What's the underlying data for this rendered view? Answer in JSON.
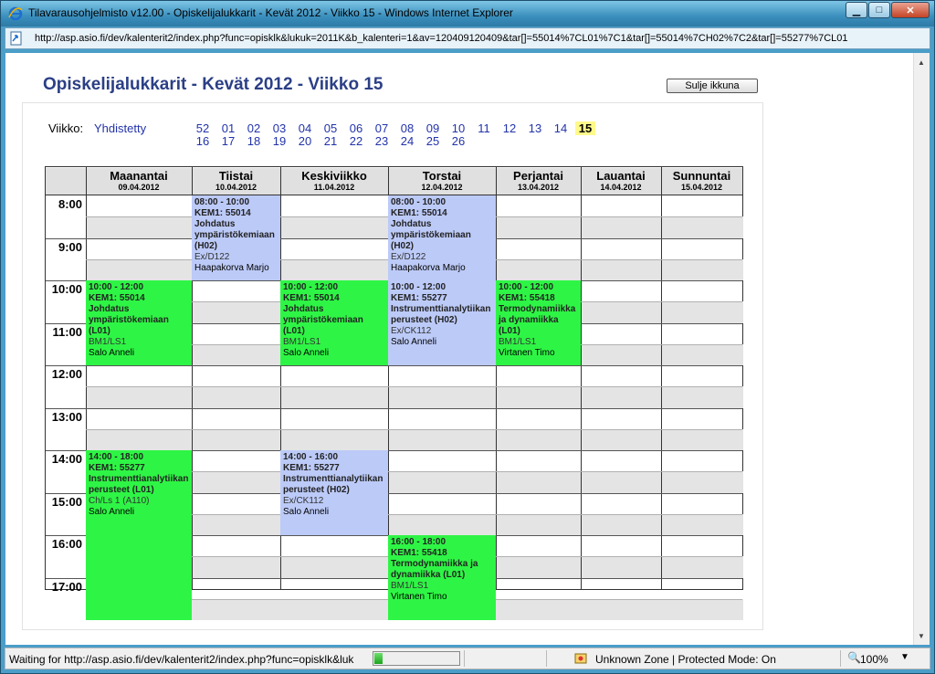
{
  "window": {
    "title": "Tilavarausohjelmisto v12.00 - Opiskelijalukkarit - Kevät 2012 - Viikko 15 - Windows Internet Explorer",
    "url": "http://asp.asio.fi/dev/kalenterit2/index.php?func=opisklk&lukuk=2011K&b_kalenteri=1&av=120409120409&tar[]=55014%7CL01%7C1&tar[]=55014%7CH02%7C2&tar[]=55277%7CL01"
  },
  "page": {
    "title": "Opiskelijalukkarit - Kevät 2012 - Viikko 15",
    "close_button": "Sulje ikkuna",
    "week_label": "Viikko:",
    "combined_link": "Yhdistetty",
    "weeks_row1": [
      "52",
      "01",
      "02",
      "03",
      "04",
      "05",
      "06",
      "07",
      "08",
      "09",
      "10",
      "11",
      "12",
      "13",
      "14",
      "15"
    ],
    "weeks_row2": [
      "16",
      "17",
      "18",
      "19",
      "20",
      "21",
      "22",
      "23",
      "24",
      "25",
      "26"
    ],
    "current_week": "15"
  },
  "calendar": {
    "days": [
      {
        "name": "Maanantai",
        "date": "09.04.2012"
      },
      {
        "name": "Tiistai",
        "date": "10.04.2012"
      },
      {
        "name": "Keskiviikko",
        "date": "11.04.2012"
      },
      {
        "name": "Torstai",
        "date": "12.04.2012"
      },
      {
        "name": "Perjantai",
        "date": "13.04.2012"
      },
      {
        "name": "Lauantai",
        "date": "14.04.2012"
      },
      {
        "name": "Sunnuntai",
        "date": "15.04.2012"
      }
    ],
    "hours": [
      "8:00",
      "9:00",
      "10:00",
      "11:00",
      "12:00",
      "13:00",
      "14:00",
      "15:00",
      "16:00",
      "17:00"
    ],
    "events": [
      {
        "day": 1,
        "start": 8,
        "end": 10,
        "color": "blue",
        "time": "08:00 - 10:00",
        "code": "KEM1: 55014",
        "name": "Johdatus ympäristökemiaan (H02)",
        "room": "Ex/D122",
        "teacher": "Haapakorva Marjo"
      },
      {
        "day": 3,
        "start": 8,
        "end": 10,
        "color": "blue",
        "time": "08:00 - 10:00",
        "code": "KEM1: 55014",
        "name": "Johdatus ympäristökemiaan (H02)",
        "room": "Ex/D122",
        "teacher": "Haapakorva Marjo"
      },
      {
        "day": 0,
        "start": 10,
        "end": 12,
        "color": "green",
        "time": "10:00 - 12:00",
        "code": "KEM1: 55014",
        "name": "Johdatus ympäristökemiaan (L01)",
        "room": "BM1/LS1",
        "teacher": "Salo Anneli"
      },
      {
        "day": 2,
        "start": 10,
        "end": 12,
        "color": "green",
        "time": "10:00 - 12:00",
        "code": "KEM1: 55014",
        "name": "Johdatus ympäristökemiaan (L01)",
        "room": "BM1/LS1",
        "teacher": "Salo Anneli"
      },
      {
        "day": 3,
        "start": 10,
        "end": 12,
        "color": "blue",
        "time": "10:00 - 12:00",
        "code": "KEM1: 55277",
        "name": "Instrumenttianalytiikan perusteet (H02)",
        "room": "Ex/CK112",
        "teacher": "Salo Anneli"
      },
      {
        "day": 4,
        "start": 10,
        "end": 12,
        "color": "green",
        "time": "10:00 - 12:00",
        "code": "KEM1: 55418",
        "name": "Termodynamiikka ja dynamiikka (L01)",
        "room": "BM1/LS1",
        "teacher": "Virtanen Timo"
      },
      {
        "day": 0,
        "start": 14,
        "end": 18,
        "color": "green",
        "time": "14:00 - 18:00",
        "code": "KEM1: 55277",
        "name": "Instrumenttianalytiikan perusteet (L01)",
        "room": "Ch/Ls 1 (A110)",
        "teacher": "Salo Anneli"
      },
      {
        "day": 2,
        "start": 14,
        "end": 16,
        "color": "blue",
        "time": "14:00 - 16:00",
        "code": "KEM1: 55277",
        "name": "Instrumenttianalytiikan perusteet (H02)",
        "room": "Ex/CK112",
        "teacher": "Salo Anneli"
      },
      {
        "day": 3,
        "start": 16,
        "end": 18,
        "color": "green",
        "time": "16:00 - 18:00",
        "code": "KEM1: 55418",
        "name": "Termodynamiikka ja dynamiikka (L01)",
        "room": "BM1/LS1",
        "teacher": "Virtanen Timo"
      }
    ]
  },
  "statusbar": {
    "text": "Waiting for http://asp.asio.fi/dev/kalenterit2/index.php?func=opisklk&luk",
    "progress": 0.1,
    "zone": "Unknown Zone | Protected Mode: On",
    "zoom": "100%"
  },
  "colors": {
    "green": "#2ef545",
    "blue": "#bccaf8",
    "current_week_bg": "#fff98a",
    "title": "#2b3f86"
  }
}
